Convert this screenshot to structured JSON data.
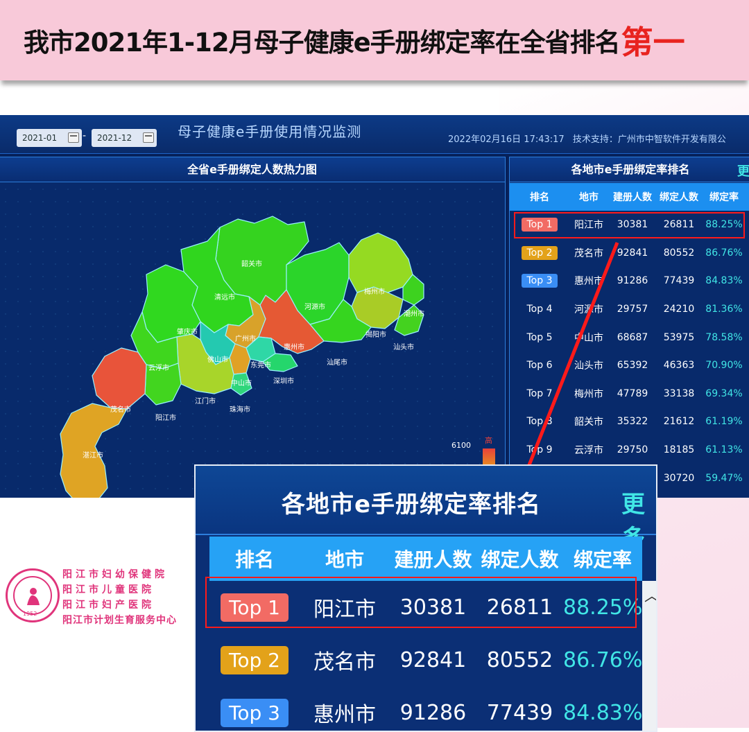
{
  "banner": {
    "title": "我市2021年1-12月母子健康e手册绑定率在全省排名",
    "emphasis": "第一"
  },
  "dashboard": {
    "date_start": "2021-01",
    "date_sep": "-",
    "date_end": "2021-12",
    "title": "母子健康e手册使用情况监测",
    "timestamp": "2022年02月16日 17:43:17",
    "support": "技术支持：广州市中智软件开发有限公",
    "map_panel_title": "全省e手册绑定人数热力图",
    "legend_max": "6100",
    "legend_high": "高",
    "year_fragment": "20",
    "cities": [
      "韶关市",
      "清远市",
      "河源市",
      "梅州市",
      "潮州市",
      "揭阳市",
      "汕头市",
      "肇庆市",
      "广州市",
      "惠州市",
      "佛山市",
      "东莞市",
      "汕尾市",
      "云浮市",
      "中山市",
      "深圳市",
      "江门市",
      "茂名市",
      "阳江市",
      "珠海市",
      "湛江市"
    ],
    "ranking_title": "各地市e手册绑定率排名",
    "more": "更",
    "columns": [
      "排名",
      "地市",
      "建册人数",
      "绑定人数",
      "绑定率"
    ],
    "rows": [
      {
        "rank": "Top 1",
        "city": "阳江市",
        "registered": "30381",
        "bound": "26811",
        "rate": "88.25%"
      },
      {
        "rank": "Top 2",
        "city": "茂名市",
        "registered": "92841",
        "bound": "80552",
        "rate": "86.76%"
      },
      {
        "rank": "Top 3",
        "city": "惠州市",
        "registered": "91286",
        "bound": "77439",
        "rate": "84.83%"
      },
      {
        "rank": "Top 4",
        "city": "河源市",
        "registered": "29757",
        "bound": "24210",
        "rate": "81.36%"
      },
      {
        "rank": "Top 5",
        "city": "中山市",
        "registered": "68687",
        "bound": "53975",
        "rate": "78.58%"
      },
      {
        "rank": "Top 6",
        "city": "汕头市",
        "registered": "65392",
        "bound": "46363",
        "rate": "70.90%"
      },
      {
        "rank": "Top 7",
        "city": "梅州市",
        "registered": "47789",
        "bound": "33138",
        "rate": "69.34%"
      },
      {
        "rank": "Top 8",
        "city": "韶关市",
        "registered": "35322",
        "bound": "21612",
        "rate": "61.19%"
      },
      {
        "rank": "Top 9",
        "city": "云浮市",
        "registered": "29750",
        "bound": "18185",
        "rate": "61.13%"
      },
      {
        "rank": "",
        "city": "",
        "registered": "",
        "bound": "30720",
        "rate": "59.47%"
      }
    ]
  },
  "zoom": {
    "title": "各地市e手册绑定率排名",
    "more": "更多",
    "scroll_icon": "chevron-up-icon"
  },
  "badge_colors": {
    "top1": "#f26b64",
    "top2": "#e3a21a",
    "top3": "#3a8ef5"
  },
  "logo": {
    "year": "1952"
  },
  "orgs": [
    "阳江市妇幼保健院",
    "阳江市儿童医院",
    "阳江市妇产医院",
    "阳江市计划生育服务中心"
  ]
}
